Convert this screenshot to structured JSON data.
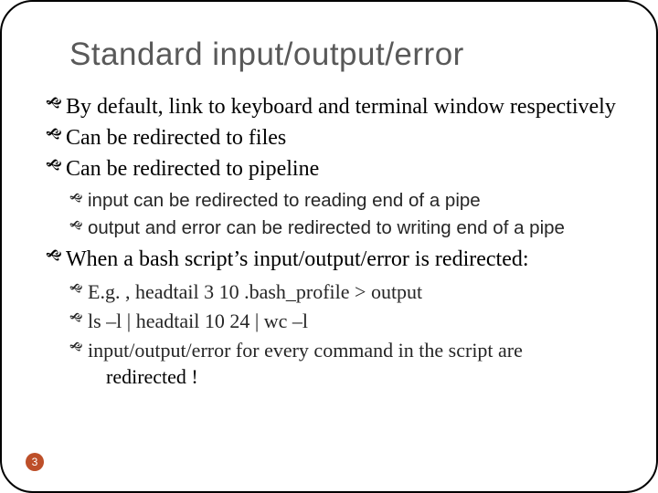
{
  "title": "Standard input/output/error",
  "bullets": {
    "b1": "By default, link to keyboard and terminal window respectively",
    "b2": "Can be redirected to files",
    "b3": "Can be redirected to pipeline",
    "b3_sub": {
      "s1": "input can be redirected to reading end of a pipe",
      "s2": "output and error can be redirected to writing end of a pipe"
    },
    "b4": "When a bash script’s input/output/error is redirected:",
    "b4_sub": {
      "s1": "E.g. , headtail 3 10 .bash_profile > output",
      "s2": "ls –l | headtail 10 24 | wc –l",
      "s3_a": " input/output/error for every command in the script are",
      "s3_b": "redirected !"
    }
  },
  "page_number": "3"
}
